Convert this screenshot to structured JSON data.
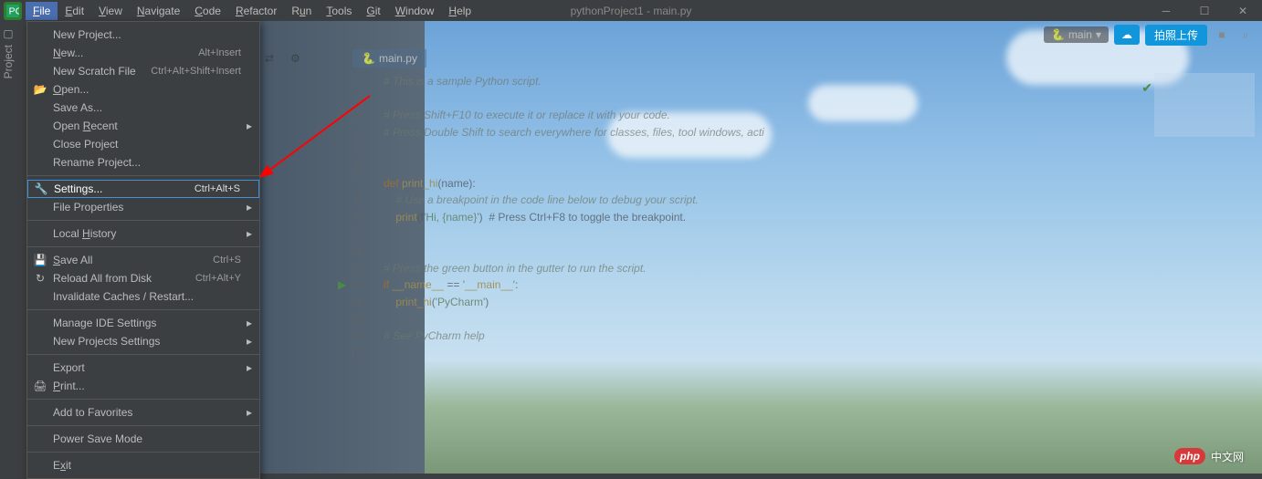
{
  "title": "pythonProject1 - main.py",
  "menubar": [
    "File",
    "Edit",
    "View",
    "Navigate",
    "Code",
    "Refactor",
    "Run",
    "Tools",
    "Git",
    "Window",
    "Help"
  ],
  "menubar_mnemonic": [
    "F",
    "E",
    "V",
    "N",
    "C",
    "R",
    "u",
    "T",
    "G",
    "W",
    "H"
  ],
  "left_tab": "Project",
  "run_config": "main",
  "upload_label": "拍照上传",
  "dropdown": {
    "groups": [
      [
        {
          "label": "New Project...",
          "shortcut": "",
          "icon": ""
        },
        {
          "label": "New...",
          "shortcut": "Alt+Insert",
          "icon": "",
          "u": "N"
        },
        {
          "label": "New Scratch File",
          "shortcut": "Ctrl+Alt+Shift+Insert",
          "icon": ""
        },
        {
          "label": "Open...",
          "shortcut": "",
          "icon": "folder",
          "u": "O"
        },
        {
          "label": "Save As...",
          "shortcut": "",
          "icon": ""
        },
        {
          "label": "Open Recent",
          "shortcut": "",
          "icon": "",
          "sub": true,
          "u": "R"
        },
        {
          "label": "Close Project",
          "shortcut": "",
          "icon": ""
        },
        {
          "label": "Rename Project...",
          "shortcut": "",
          "icon": ""
        }
      ],
      [
        {
          "label": "Settings...",
          "shortcut": "Ctrl+Alt+S",
          "icon": "wrench",
          "selected": true
        },
        {
          "label": "File Properties",
          "shortcut": "",
          "icon": "",
          "sub": true
        }
      ],
      [
        {
          "label": "Local History",
          "shortcut": "",
          "icon": "",
          "sub": true,
          "u": "H"
        }
      ],
      [
        {
          "label": "Save All",
          "shortcut": "Ctrl+S",
          "icon": "save",
          "u": "S"
        },
        {
          "label": "Reload All from Disk",
          "shortcut": "Ctrl+Alt+Y",
          "icon": "reload"
        },
        {
          "label": "Invalidate Caches / Restart...",
          "shortcut": "",
          "icon": ""
        }
      ],
      [
        {
          "label": "Manage IDE Settings",
          "shortcut": "",
          "icon": "",
          "sub": true
        },
        {
          "label": "New Projects Settings",
          "shortcut": "",
          "icon": "",
          "sub": true
        }
      ],
      [
        {
          "label": "Export",
          "shortcut": "",
          "icon": "",
          "sub": true
        },
        {
          "label": "Print...",
          "shortcut": "",
          "icon": "print",
          "u": "P"
        }
      ],
      [
        {
          "label": "Add to Favorites",
          "shortcut": "",
          "icon": "",
          "sub": true
        }
      ],
      [
        {
          "label": "Power Save Mode",
          "shortcut": "",
          "icon": ""
        }
      ],
      [
        {
          "label": "Exit",
          "shortcut": "",
          "icon": "",
          "u": "x"
        }
      ]
    ]
  },
  "tab_name": "main.py",
  "code_lines": [
    "# This is a sample Python script.",
    "",
    "# Press Shift+F10 to execute it or replace it with your code.",
    "# Press Double Shift to search everywhere for classes, files, tool windows, acti",
    "",
    "",
    "def print_hi(name):",
    "    # Use a breakpoint in the code line below to debug your script.",
    "    print(f'Hi, {name}')  # Press Ctrl+F8 to toggle the breakpoint.",
    "",
    "",
    "# Press the green button in the gutter to run the script.",
    "if __name__ == '__main__':",
    "    print_hi('PyCharm')",
    "",
    "# See PyCharm help",
    ""
  ],
  "watermark": {
    "logo": "php",
    "text": "中文网"
  }
}
